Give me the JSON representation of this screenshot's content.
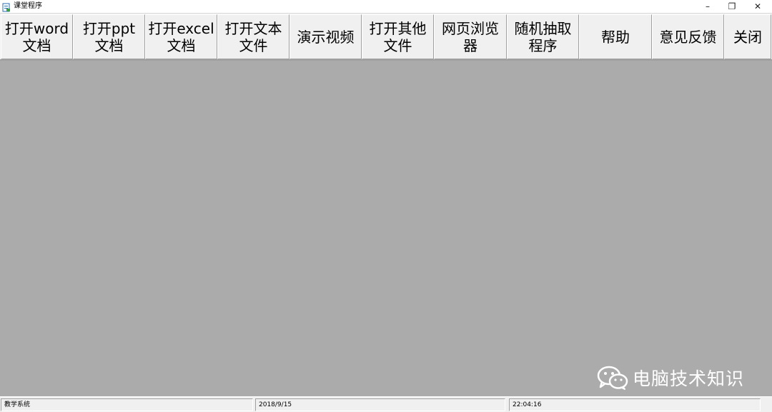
{
  "window": {
    "title": "课堂程序",
    "controls": {
      "minimize": "–",
      "maximize": "❐",
      "close": "✕"
    }
  },
  "toolbar": {
    "buttons": [
      {
        "label": "打开word文档"
      },
      {
        "label": "打开ppt文档"
      },
      {
        "label": "打开excel文档"
      },
      {
        "label": "打开文本文件"
      },
      {
        "label": "演示视频"
      },
      {
        "label": "打开其他文件"
      },
      {
        "label": "网页浏览器"
      },
      {
        "label": "随机抽取程序"
      },
      {
        "label": "帮助"
      },
      {
        "label": "意见反馈"
      },
      {
        "label": "关闭"
      }
    ]
  },
  "watermark": {
    "text": "电脑技术知识",
    "icon": "wechat-icon"
  },
  "statusbar": {
    "panels": [
      {
        "text": "教学系统"
      },
      {
        "text": "2018/9/15"
      },
      {
        "text": "22:04:16"
      }
    ]
  },
  "colors": {
    "client_background": "#ababab",
    "toolbar_background": "#f0f0f0",
    "watermark_text": "#ffffff"
  }
}
